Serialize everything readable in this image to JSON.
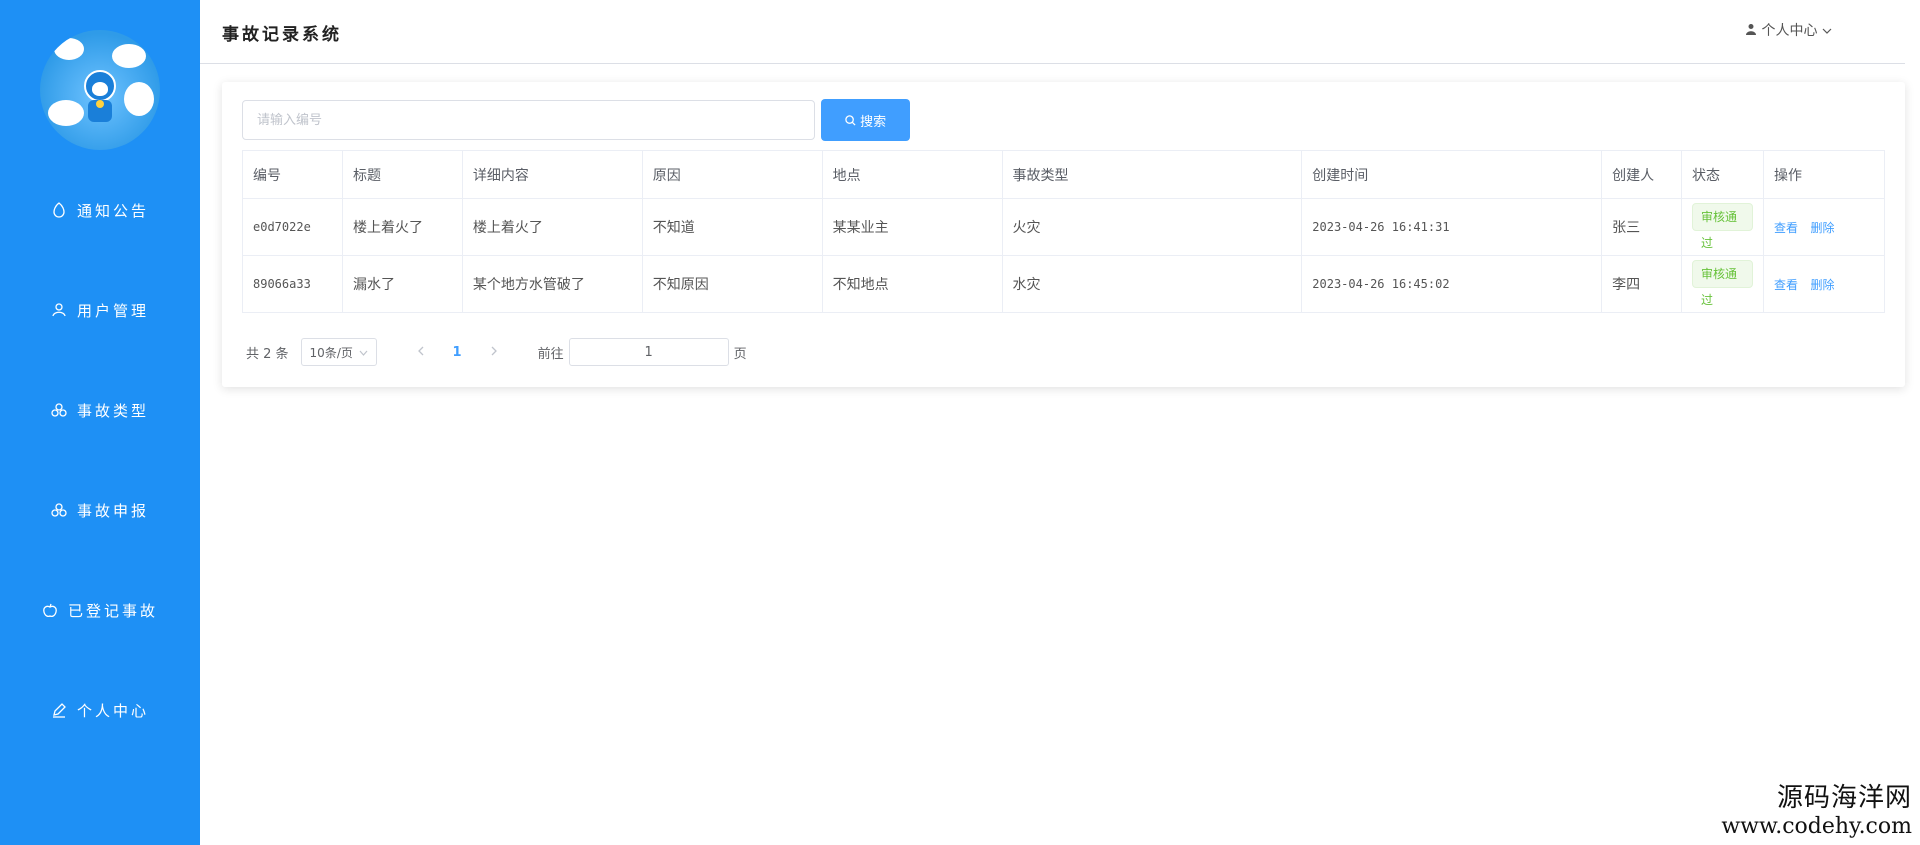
{
  "header": {
    "title": "事故记录系统",
    "user_menu": "个人中心"
  },
  "sidebar": {
    "items": [
      {
        "label": "通知公告",
        "icon": "bell-icon"
      },
      {
        "label": "用户管理",
        "icon": "users-icon"
      },
      {
        "label": "事故类型",
        "icon": "cluster-icon"
      },
      {
        "label": "事故申报",
        "icon": "cluster-icon"
      },
      {
        "label": "已登记事故",
        "icon": "apple-icon"
      },
      {
        "label": "个人中心",
        "icon": "edit-icon"
      }
    ]
  },
  "search": {
    "placeholder": "请输入编号",
    "button": "搜索"
  },
  "table": {
    "columns": [
      "编号",
      "标题",
      "详细内容",
      "原因",
      "地点",
      "事故类型",
      "创建时间",
      "创建人",
      "状态",
      "操作"
    ],
    "rows": [
      {
        "id": "e0d7022e",
        "title": "楼上着火了",
        "detail": "楼上着火了",
        "reason": "不知道",
        "place": "某某业主",
        "type": "火灾",
        "created": "2023-04-26 16:41:31",
        "creator": "张三",
        "status": "审核通过"
      },
      {
        "id": "89066a33",
        "title": "漏水了",
        "detail": "某个地方水管破了",
        "reason": "不知原因",
        "place": "不知地点",
        "type": "水灾",
        "created": "2023-04-26 16:45:02",
        "creator": "李四",
        "status": "审核通过"
      }
    ],
    "actions": {
      "view": "查看",
      "delete": "删除"
    }
  },
  "pagination": {
    "total": "共 2 条",
    "page_size": "10条/页",
    "current": "1",
    "goto_prefix": "前往",
    "goto_value": "1",
    "goto_suffix": "页"
  },
  "watermark": {
    "line1": "源码海洋网",
    "line2": "www.codehy.com"
  },
  "colors": {
    "sidebar": "#1e90f5",
    "primary": "#409eff",
    "success": "#67c23a"
  }
}
